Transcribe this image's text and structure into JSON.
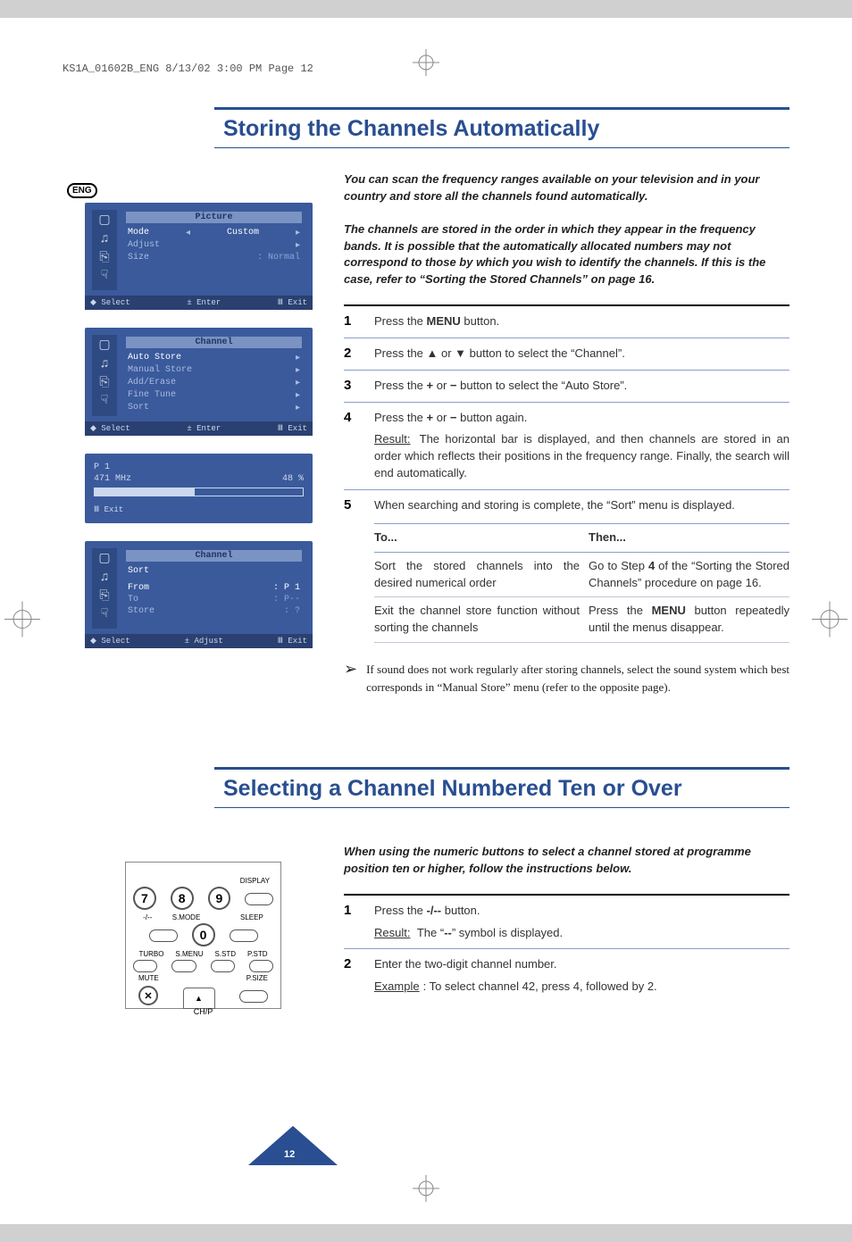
{
  "doc_header": "KS1A_01602B_ENG  8/13/02  3:00 PM  Page 12",
  "lang_badge": "ENG",
  "section1": {
    "title": "Storing the Channels Automatically",
    "intro1": "You can scan the frequency ranges available on your television and in your country and store all the channels found automatically.",
    "intro2": "The channels are stored in the order in which they appear in the frequency bands. It is possible that the automatically allocated numbers may not correspond to those by which you wish to identify the channels. If this is the case, refer to “Sorting the Stored Channels” on page 16.",
    "steps": [
      {
        "n": "1",
        "body": "Press the <b>MENU</b> button."
      },
      {
        "n": "2",
        "body": "Press the ▲ or ▼ button to select the “Channel”."
      },
      {
        "n": "3",
        "body": "Press the <b>+</b> or <b>−</b> button to select the “Auto Store”."
      },
      {
        "n": "4",
        "body": "Press the <b>+</b> or <b>−</b> button again.",
        "result": "The horizontal bar is displayed, and then channels are stored in an order which reflects their positions in the frequency range. Finally, the search will end automatically."
      },
      {
        "n": "5",
        "body": "When searching and storing is complete, the “Sort” menu is displayed."
      }
    ],
    "table": {
      "h1": "To...",
      "h2": "Then...",
      "rows": [
        {
          "c1": "Sort the stored channels into the desired numerical order",
          "c2": "Go to Step <b>4</b> of the “Sorting the Stored Channels” procedure on page 16."
        },
        {
          "c1": "Exit the channel store function without sorting the channels",
          "c2": "Press the <b>MENU</b> button repeatedly until the menus disappear."
        }
      ]
    },
    "note": "If sound does not work regularly after storing channels, select the sound system which best corresponds in “Manual Store” menu (refer to the opposite page)."
  },
  "osd": {
    "foot_select": "Select",
    "foot_enter": "Enter",
    "foot_adjust": "Adjust",
    "foot_exit": "Exit",
    "picture": {
      "title": "Picture",
      "rows": [
        {
          "label": "Mode",
          "value": "Custom",
          "hi": true,
          "arrows": "both"
        },
        {
          "label": "Adjust",
          "value": "",
          "arrows": "right"
        },
        {
          "label": "Size",
          "value": "Normal",
          "arrows": "colon"
        }
      ]
    },
    "channel": {
      "title": "Channel",
      "rows": [
        {
          "label": "Auto Store",
          "hi": true
        },
        {
          "label": "Manual Store"
        },
        {
          "label": "Add/Erase"
        },
        {
          "label": "Fine Tune"
        },
        {
          "label": "Sort"
        }
      ]
    },
    "progress": {
      "line1": "P 1",
      "line2": "471 MHz",
      "percent": "48 %",
      "fill": 48
    },
    "sort": {
      "title": "Channel",
      "head": "Sort",
      "rows": [
        {
          "label": "From",
          "value": ": P 1",
          "hi": true
        },
        {
          "label": "To",
          "value": ": P--"
        },
        {
          "label": "Store",
          "value": ": ?"
        }
      ]
    }
  },
  "section2": {
    "title": "Selecting a Channel Numbered Ten or Over",
    "intro": "When using the numeric buttons to select a channel stored at programme position ten or higher, follow the instructions below.",
    "steps": [
      {
        "n": "1",
        "body": "Press the <b>-/--</b> button.",
        "result": "The “<b>--</b>” symbol is displayed."
      },
      {
        "n": "2",
        "body": "Enter the two-digit channel number.",
        "example": "To select channel 42, press 4, followed by 2."
      }
    ]
  },
  "remote": {
    "digits": [
      "7",
      "8",
      "9",
      "0"
    ],
    "top_labels": [
      "",
      "",
      "",
      "DISPLAY"
    ],
    "mid_labels": [
      "-/--",
      "S.MODE",
      "",
      "SLEEP"
    ],
    "row3_labels": [
      "TURBO",
      "S.MENU",
      "S.STD",
      "P.STD"
    ],
    "row4_left": "MUTE",
    "row4_right": "P.SIZE",
    "chp": "CH/P"
  },
  "page_number": "12"
}
